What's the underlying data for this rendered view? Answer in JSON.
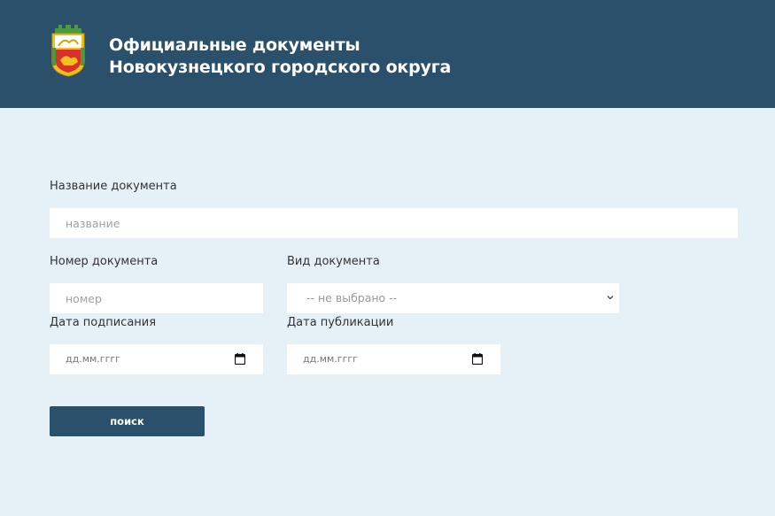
{
  "header": {
    "title_line1": "Официальные документы",
    "title_line2": "Новокузнецкого городского округа",
    "logo_icon": "city-coat-of-arms-icon"
  },
  "form": {
    "name": {
      "label": "Название документа",
      "placeholder": "название",
      "value": ""
    },
    "number": {
      "label": "Номер документа",
      "placeholder": "номер",
      "value": ""
    },
    "type": {
      "label": "Вид документа",
      "selected": "-- не выбрано --"
    },
    "sign_date": {
      "label": "Дата подписания",
      "placeholder": "дд.мм.гггг"
    },
    "pub_date": {
      "label": "Дата публикации",
      "placeholder": "дд.мм.гггг"
    },
    "submit_label": "поиск"
  },
  "colors": {
    "header_bg": "#2b506b",
    "page_bg": "#e6f0f7",
    "button_bg": "#2b506b"
  }
}
